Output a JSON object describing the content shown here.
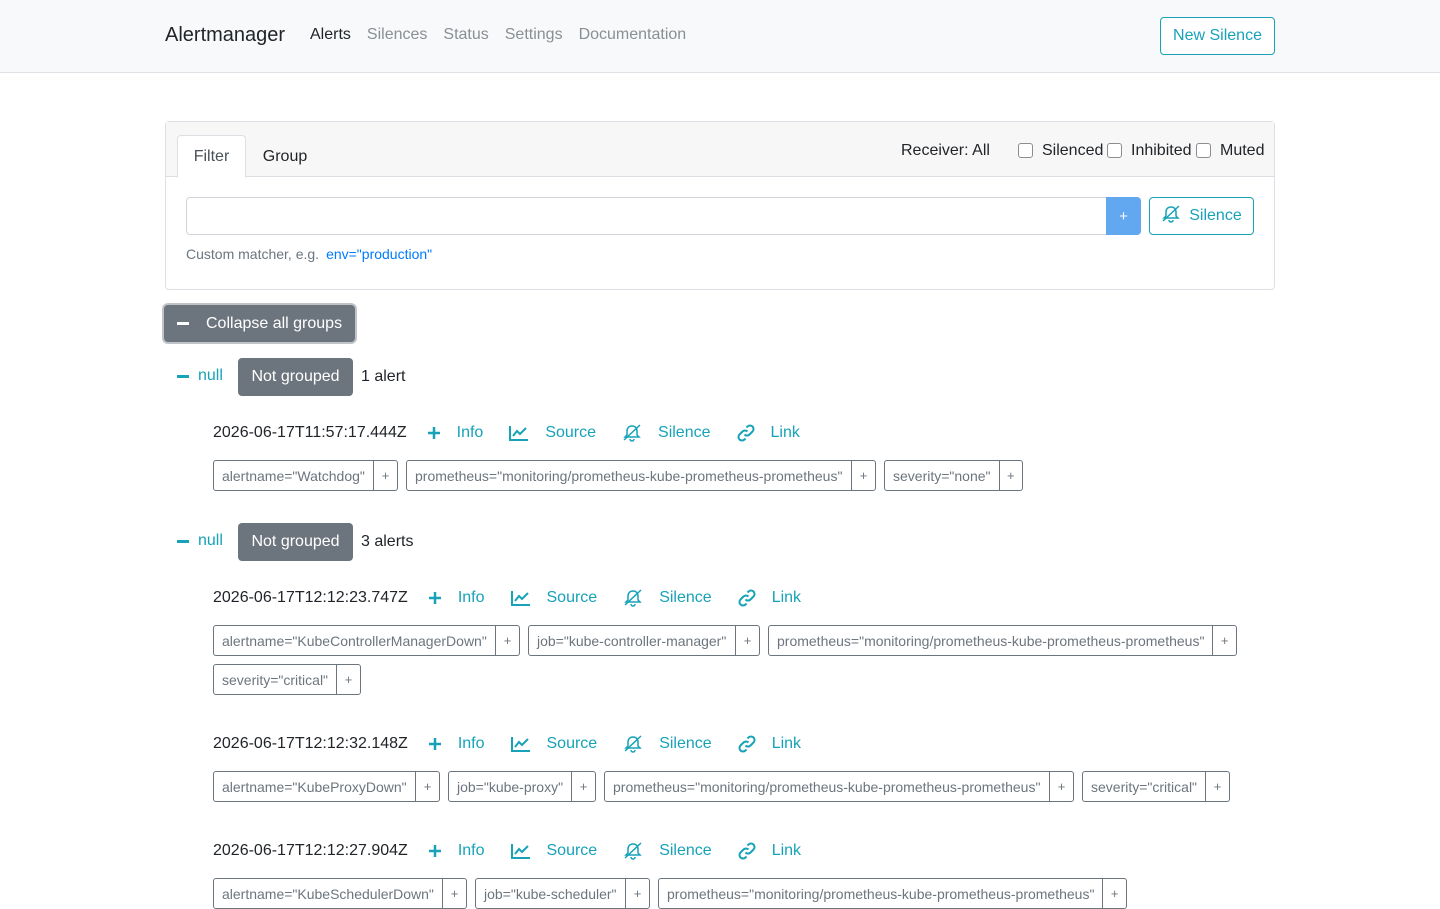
{
  "navbar": {
    "brand": "Alertmanager",
    "links": [
      "Alerts",
      "Silences",
      "Status",
      "Settings",
      "Documentation"
    ],
    "new_silence": "New Silence"
  },
  "filter": {
    "tabs": [
      "Filter",
      "Group"
    ],
    "receiver": "Receiver: All",
    "checkboxes": [
      "Silenced",
      "Inhibited",
      "Muted"
    ],
    "input_value": "",
    "add_label": "+",
    "silence_label": "Silence",
    "hint": "Custom matcher, e.g.",
    "hint_example": "env=\"production\""
  },
  "collapse_all": "Collapse all groups",
  "actions": [
    "Info",
    "Source",
    "Silence",
    "Link"
  ],
  "plus": "+",
  "groups": [
    {
      "toggle": "null",
      "badge": "Not grouped",
      "count": "1 alert",
      "alerts": [
        {
          "timestamp": "2026-06-17T11:57:17.444Z",
          "labels": [
            "alertname=\"Watchdog\"",
            "prometheus=\"monitoring/prometheus-kube-prometheus-prometheus\"",
            "severity=\"none\""
          ]
        }
      ]
    },
    {
      "toggle": "null",
      "badge": "Not grouped",
      "count": "3 alerts",
      "alerts": [
        {
          "timestamp": "2026-06-17T12:12:23.747Z",
          "labels": [
            "alertname=\"KubeControllerManagerDown\"",
            "job=\"kube-controller-manager\"",
            "prometheus=\"monitoring/prometheus-kube-prometheus-prometheus\"",
            "severity=\"critical\""
          ]
        },
        {
          "timestamp": "2026-06-17T12:12:32.148Z",
          "labels": [
            "alertname=\"KubeProxyDown\"",
            "job=\"kube-proxy\"",
            "prometheus=\"monitoring/prometheus-kube-prometheus-prometheus\"",
            "severity=\"critical\""
          ]
        },
        {
          "timestamp": "2026-06-17T12:12:27.904Z",
          "labels": [
            "alertname=\"KubeSchedulerDown\"",
            "job=\"kube-scheduler\"",
            "prometheus=\"monitoring/prometheus-kube-prometheus-prometheus\""
          ]
        }
      ]
    }
  ],
  "colors": {
    "accent": "#17a2b8",
    "secondary": "#6c757d",
    "primary_light": "#62a8f0",
    "link": "#007bff"
  }
}
